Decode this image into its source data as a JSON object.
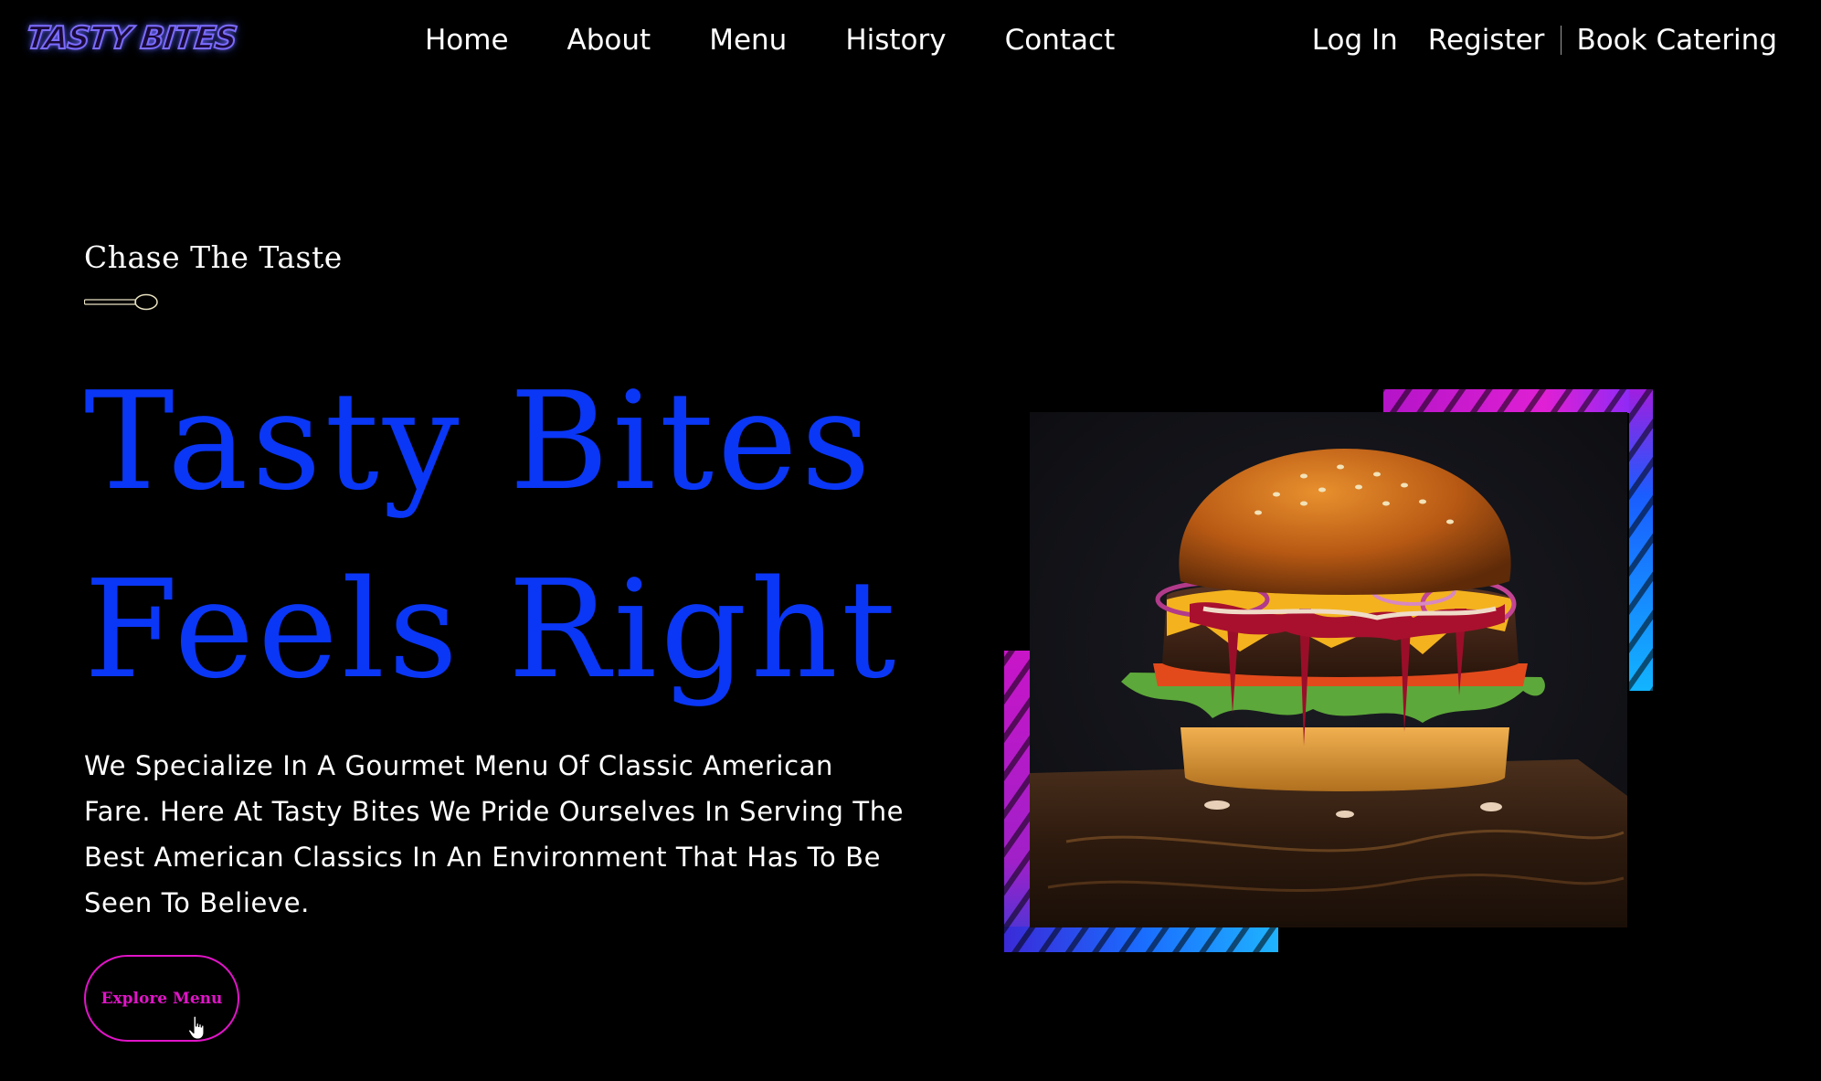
{
  "brand": {
    "logo_text": "TASTY BITES"
  },
  "nav": {
    "items": [
      "Home",
      "About",
      "Menu",
      "History",
      "Contact"
    ]
  },
  "auth": {
    "login": "Log In",
    "register": "Register",
    "book_catering": "Book Catering"
  },
  "hero": {
    "tagline": "Chase The Taste",
    "title_line_1": "Tasty Bites",
    "title_line_2": "Feels Right",
    "description": "We Specialize In A Gourmet Menu Of Classic American Fare. Here At Tasty Bites We Pride Ourselves In Serving The Best American Classics In An Environment That Has To Be Seen To Believe.",
    "cta_label": "Explore Menu"
  },
  "icons": {
    "divider": "spoon-icon",
    "cursor": "hand-pointer-icon",
    "image": "burger-photo"
  },
  "colors": {
    "background": "#000000",
    "title_blue": "#0a36f5",
    "accent_magenta": "#e114c8",
    "accent_cyan": "#1fa8ff",
    "logo_purple": "#7b6cff"
  }
}
